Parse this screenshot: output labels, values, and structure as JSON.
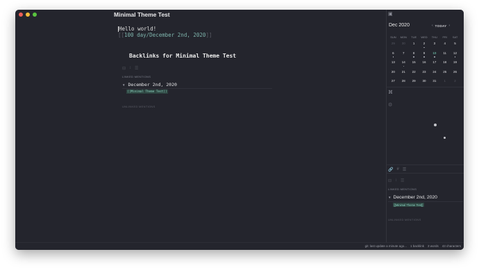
{
  "window": {
    "title": "Minimal Theme Test"
  },
  "editor": {
    "line1": "Hello world!",
    "link_open": "[[",
    "link_text": "100 day/December 2nd, 2020",
    "link_close": "]]"
  },
  "backlinks": {
    "heading": "Backlinks for Minimal Theme Test",
    "linked_label": "LINKED MENTIONS",
    "file": "December 2nd, 2020",
    "snippet": "[[Minimal Theme Test]]",
    "unlinked_label": "UNLINKED MENTIONS"
  },
  "calendar": {
    "month": "Dec 2020",
    "today_label": "TODAY",
    "prev_icon": "chevron-left-icon",
    "next_icon": "chevron-right-icon",
    "weekdays": [
      "SUN",
      "MON",
      "TUE",
      "WED",
      "THU",
      "FRI",
      "SAT"
    ],
    "weeks": [
      [
        "29",
        "30",
        "1",
        "2",
        "3",
        "4",
        "5"
      ],
      [
        "6",
        "7",
        "8",
        "9",
        "10",
        "11",
        "12"
      ],
      [
        "13",
        "14",
        "15",
        "16",
        "17",
        "18",
        "19"
      ],
      [
        "20",
        "21",
        "22",
        "23",
        "24",
        "25",
        "26"
      ],
      [
        "27",
        "28",
        "29",
        "30",
        "31",
        "1",
        "2"
      ]
    ]
  },
  "sidebar_backlinks": {
    "linked_label": "LINKED MENTIONS",
    "file": "December 2nd, 2020",
    "snippet": "[[Minimal Theme Test]]",
    "unlinked_label": "UNLINKED MENTIONS"
  },
  "status": {
    "git": "git: last update a minute ago...",
    "backlinks": "1 backlink",
    "words": "3 words",
    "chars": "43 characters"
  },
  "colors": {
    "background": "#24252d",
    "accent": "#7fb5ad",
    "link_highlight": "#2e4541"
  }
}
